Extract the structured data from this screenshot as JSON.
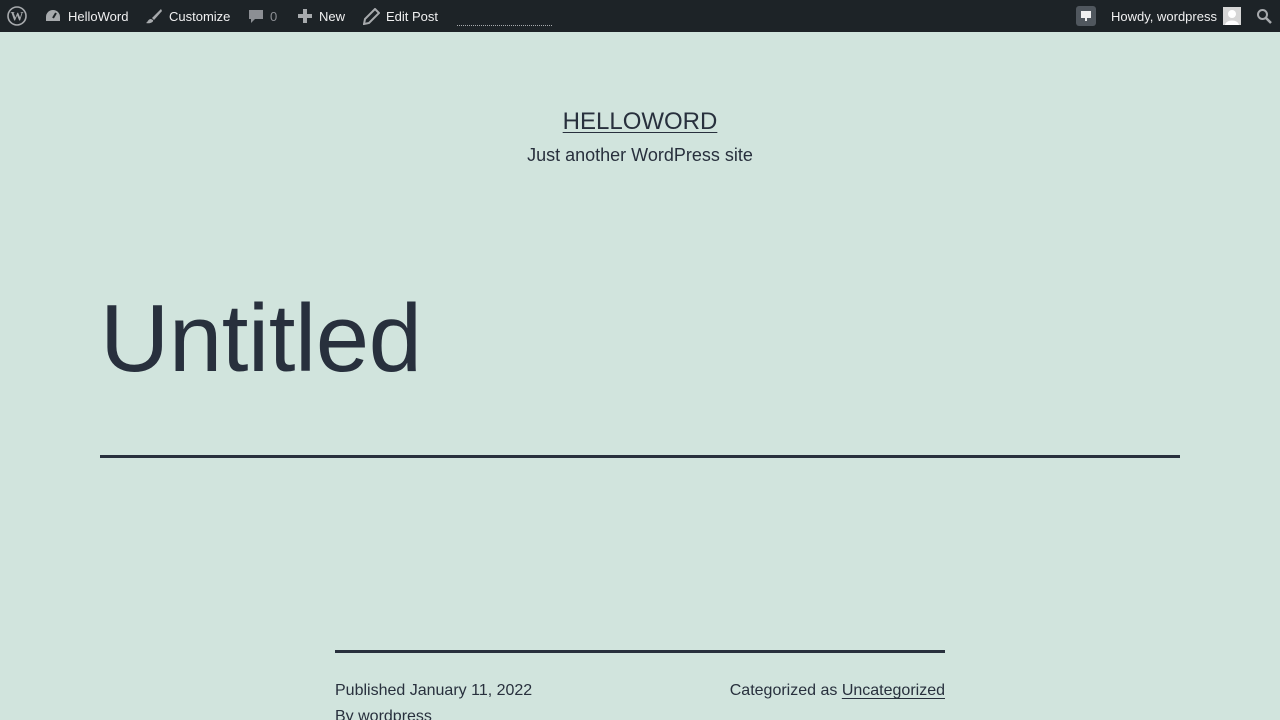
{
  "adminbar": {
    "site_name": "HelloWord",
    "customize_label": "Customize",
    "comments_count": "0",
    "new_label": "New",
    "edit_label": "Edit Post",
    "howdy_label": "Howdy, wordpress"
  },
  "site": {
    "title": "HELLOWORD",
    "description": "Just another WordPress site"
  },
  "post": {
    "title": "Untitled",
    "published_prefix": "Published",
    "published_date": "January 11, 2022",
    "category_prefix": "Categorized as",
    "category": "Uncategorized",
    "by_prefix": "By",
    "author": "wordpress"
  },
  "colors": {
    "background": "#d1e4dd",
    "adminbar": "#1d2327",
    "text": "#28303d"
  }
}
